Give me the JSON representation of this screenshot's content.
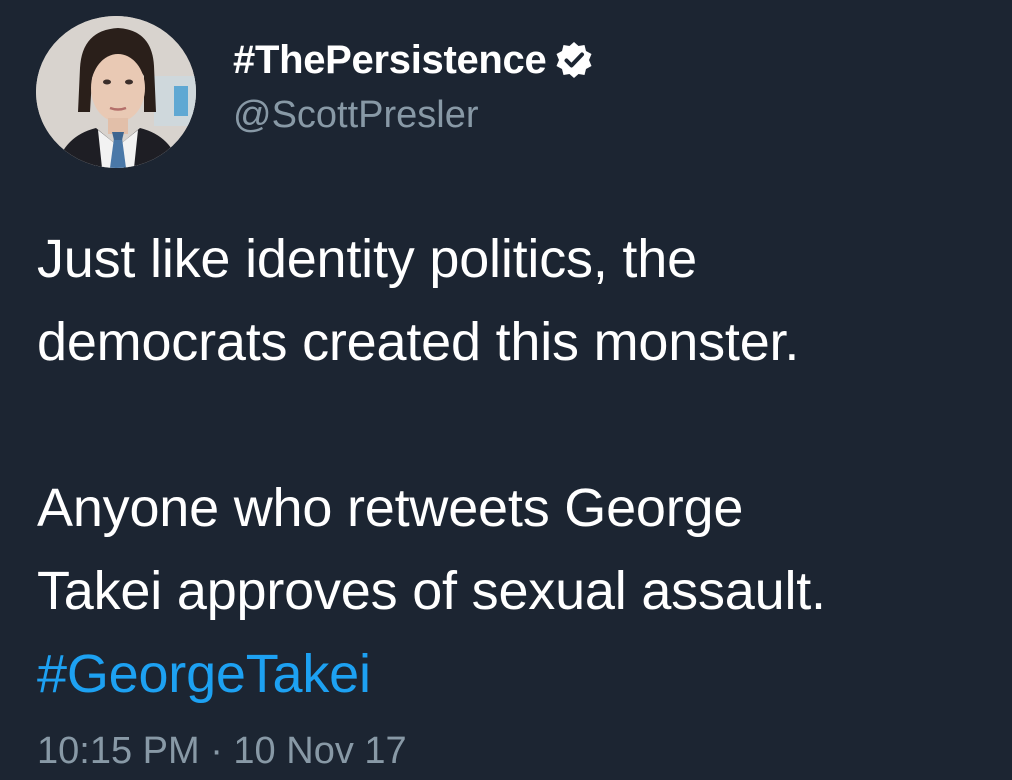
{
  "tweet": {
    "author": {
      "display_name": "#ThePersistence",
      "handle": "@ScottPresler",
      "verified": true,
      "verified_icon": "verified-badge-icon",
      "avatar_icon": "profile-photo"
    },
    "text_lines": [
      "Just like identity politics, the",
      "democrats created this monster.",
      "",
      "Anyone who retweets George",
      "Takei approves of sexual assault."
    ],
    "hashtag": "#GeorgeTakei",
    "timestamp": "10:15 PM · 10 Nov 17"
  },
  "colors": {
    "background": "#1c2532",
    "text": "#ffffff",
    "secondary": "#8899a6",
    "link": "#1da1f2"
  }
}
